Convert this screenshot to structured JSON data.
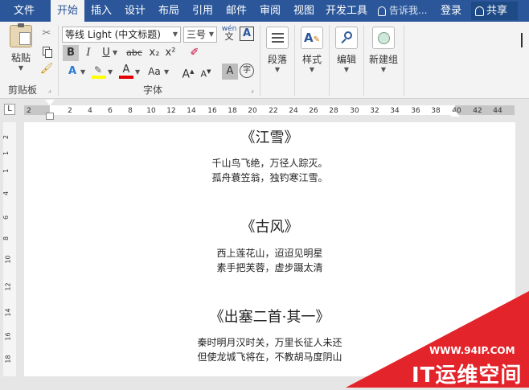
{
  "tabs": [
    {
      "label": "文件"
    },
    {
      "label": "开始"
    },
    {
      "label": "插入"
    },
    {
      "label": "设计"
    },
    {
      "label": "布局"
    },
    {
      "label": "引用"
    },
    {
      "label": "邮件"
    },
    {
      "label": "审阅"
    },
    {
      "label": "视图"
    },
    {
      "label": "开发工具"
    }
  ],
  "tell_me": "告诉我...",
  "login": "登录",
  "share": "共享",
  "clipboard": {
    "paste_label": "粘贴",
    "group_label": "剪贴板"
  },
  "font": {
    "font_name": "等线 Light (中文标题)",
    "font_size": "三号",
    "phonetic_label": "wén",
    "group_label": "字体",
    "bold": "B",
    "italic": "I",
    "underline": "U",
    "strike": "abc",
    "subscript": "x₂",
    "superscript": "x²",
    "text_effect": "A",
    "font_color_letter": "A",
    "change_case": "Aa",
    "grow": "A",
    "shrink": "A",
    "shade": "A",
    "enclose": "字",
    "colors": {
      "highlight": "#ffff00",
      "font_color": "#e00000"
    }
  },
  "paragraph_label": "段落",
  "styles_label": "样式",
  "editing_label": "编辑",
  "newgroup_label": "新建组",
  "ruler": {
    "labels": [
      "2",
      "2",
      "4",
      "6",
      "8",
      "10",
      "12",
      "14",
      "16",
      "18",
      "20",
      "22",
      "24",
      "26",
      "28",
      "30",
      "32",
      "34",
      "36",
      "38",
      "40",
      "42",
      "44"
    ],
    "vlabels": [
      "2",
      "1",
      "1",
      "4",
      "6",
      "8",
      "10",
      "12",
      "14",
      "16",
      "18"
    ]
  },
  "document": {
    "poems": [
      {
        "title": "《江雪》",
        "lines": [
          "千山鸟飞绝，万径人踪灭。",
          "孤舟蓑笠翁，独钓寒江雪。"
        ]
      },
      {
        "title": "《古风》",
        "lines": [
          "西上莲花山，迢迢见明星",
          "素手把芙蓉，虚步蹑太清"
        ]
      },
      {
        "title": "《出塞二首·其一》",
        "lines": [
          "秦时明月汉时关，万里长征人未还",
          "但使龙城飞将在，不教胡马度阴山"
        ]
      }
    ]
  },
  "watermark": {
    "url": "WWW.94IP.COM",
    "text": "IT运维空间",
    "color": "#e3242b"
  },
  "colors": {
    "accent": "#2b579a"
  }
}
